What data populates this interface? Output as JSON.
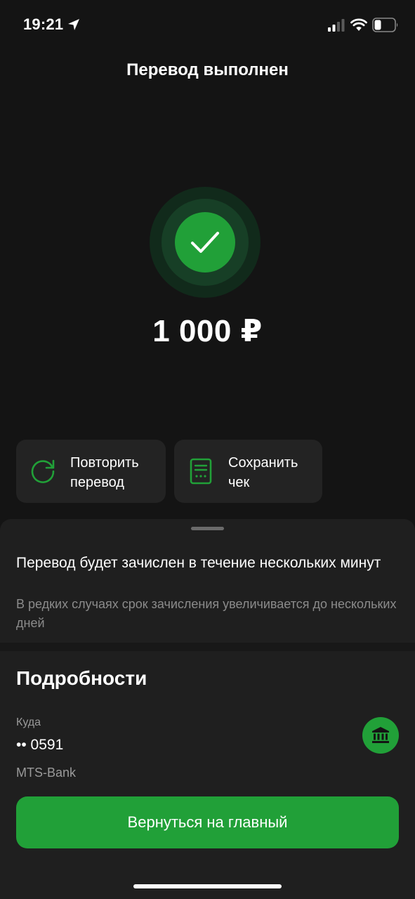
{
  "status_bar": {
    "time": "19:21",
    "icons": [
      "location-arrow-icon",
      "cellular-signal-icon",
      "wifi-icon",
      "battery-icon"
    ]
  },
  "header": {
    "title": "Перевод выполнен"
  },
  "success": {
    "icon": "checkmark-icon",
    "amount": "1 000 ₽"
  },
  "actions": [
    {
      "label": "Повторить перевод",
      "icon": "repeat-icon"
    },
    {
      "label": "Сохранить чек",
      "icon": "receipt-icon"
    }
  ],
  "notice": {
    "title": "Перевод будет зачислен в течение нескольких минут",
    "subtitle": "В редких случаях срок зачисления увеличивается до нескольких дней"
  },
  "details": {
    "title": "Подробности",
    "destination_label": "Куда",
    "destination_account": "•• 0591",
    "destination_bank": "MTS-Bank",
    "bank_icon": "bank-icon"
  },
  "footer": {
    "home_button_label": "Вернуться на главный"
  },
  "colors": {
    "background": "#141414",
    "sheet": "#1f1f1f",
    "card": "#232323",
    "accent_green": "#21a038",
    "secondary_text": "#8b8b8b"
  }
}
